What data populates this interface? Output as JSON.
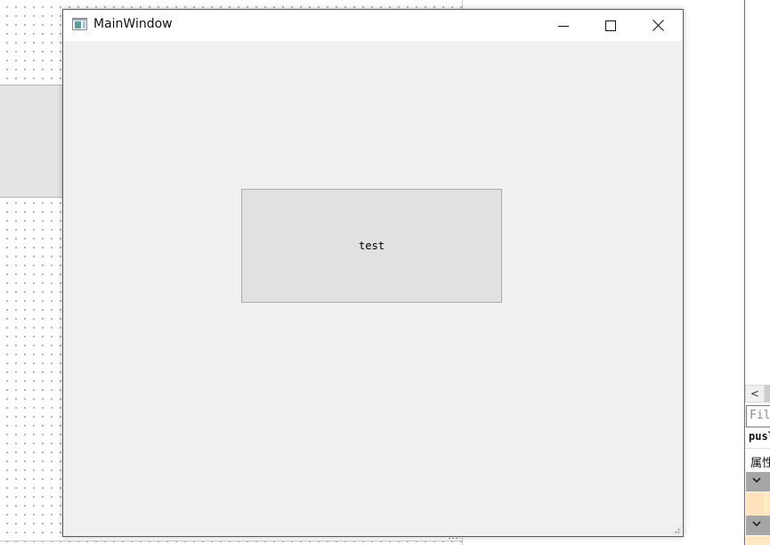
{
  "window": {
    "title": "MainWindow",
    "minimize_icon": "minimize-icon",
    "maximize_icon": "maximize-icon",
    "close_icon": "close-icon"
  },
  "main": {
    "button_label": "test"
  },
  "right_panel": {
    "scroll_left_glyph": "<",
    "filter_placeholder": "Fil",
    "object_name": "pusl",
    "property_header": "属性"
  },
  "colors": {
    "title_bar": "#ffffff",
    "client_background": "#f0f0f0",
    "button_face": "#e1e1e1",
    "button_border": "#adadad",
    "group_row": "#a6a6a6",
    "property_row": "#ffe7c2"
  }
}
